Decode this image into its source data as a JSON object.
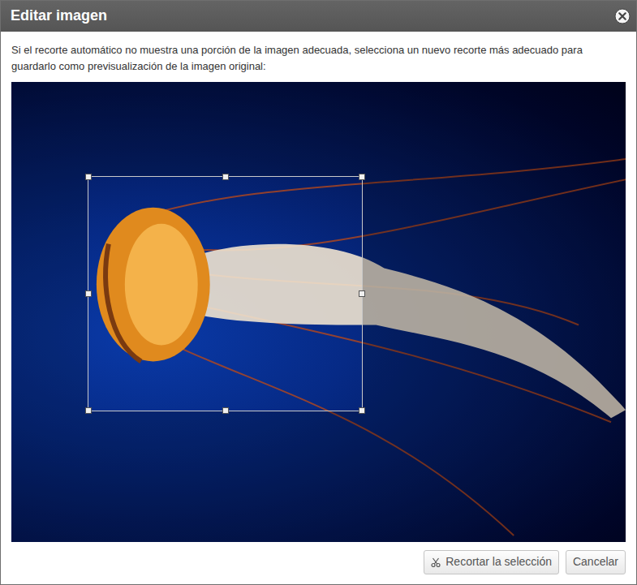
{
  "window": {
    "title": "Editar imagen"
  },
  "instructions": "Si el recorte automático no muestra una porción de la imagen adecuada, selecciona un nuevo recorte más adecuado para guardarlo como previsualización de la imagen original:",
  "buttons": [
    {
      "label": "Recortar la selección",
      "kind": "crop"
    },
    {
      "label": "Cancelar",
      "kind": "cancel"
    }
  ]
}
